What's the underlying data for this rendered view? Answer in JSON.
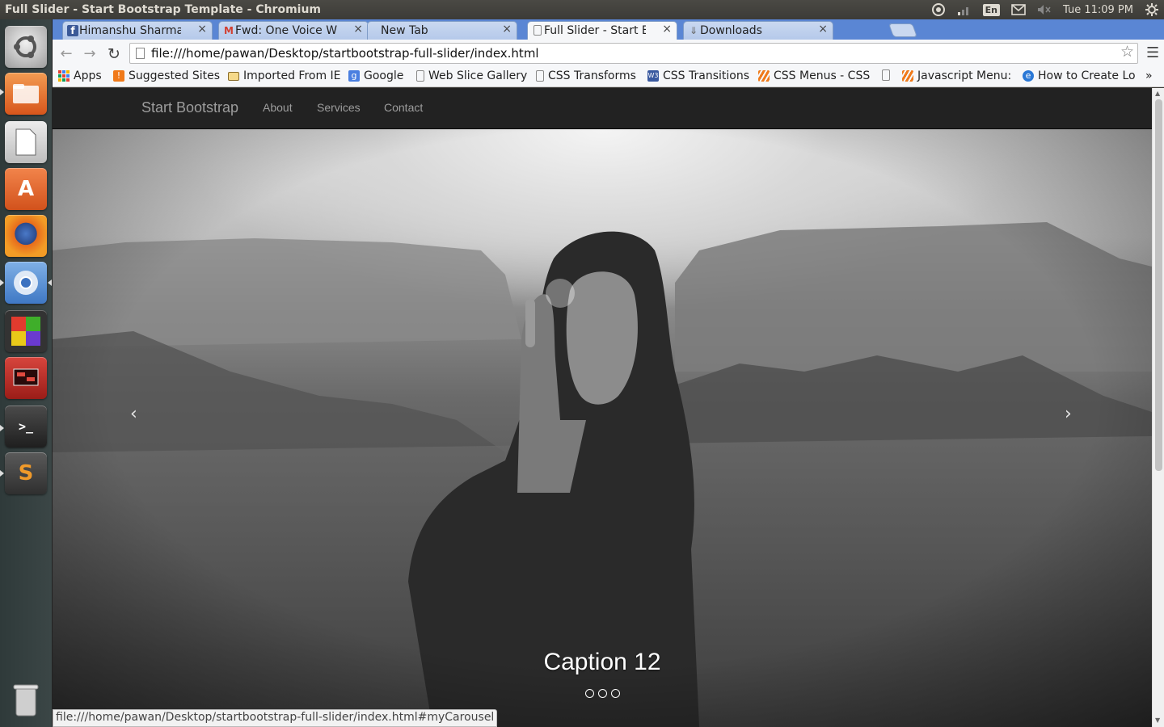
{
  "os": {
    "window_title": "Full Slider - Start Bootstrap Template - Chromium",
    "keyboard_layout": "En",
    "clock": "Tue 11:09 PM"
  },
  "launcher": {
    "items": [
      "ubuntu-dash",
      "files",
      "text-editor",
      "software-center",
      "firefox",
      "chromium",
      "color-app",
      "remmina",
      "terminal",
      "sublime-text",
      "trash"
    ]
  },
  "browser": {
    "tabs": [
      {
        "label": "Himanshu Sharma - ",
        "icon": "facebook-icon",
        "active": false
      },
      {
        "label": "Fwd: One Voice Web",
        "icon": "gmail-icon",
        "active": false
      },
      {
        "label": "New Tab",
        "icon": "",
        "active": false
      },
      {
        "label": "Full Slider - Start Boo",
        "icon": "page-icon",
        "active": true
      },
      {
        "label": "Downloads",
        "icon": "download-icon",
        "active": false
      }
    ],
    "close_glyph": "×",
    "url": "file:///home/pawan/Desktop/startbootstrap-full-slider/index.html",
    "bookmarks": [
      {
        "label": "Apps",
        "icon": "apps-grid-icon"
      },
      {
        "label": "Suggested Sites",
        "icon": "suggested-sites-icon"
      },
      {
        "label": "Imported From IE",
        "icon": "folder-icon"
      },
      {
        "label": "Google",
        "icon": "google-icon"
      },
      {
        "label": "Web Slice Gallery",
        "icon": "page-icon"
      },
      {
        "label": "CSS Transforms",
        "icon": "page-icon"
      },
      {
        "label": "CSS Transitions",
        "icon": "w3schools-icon"
      },
      {
        "label": "CSS Menus - CSS t",
        "icon": "stripes-icon"
      },
      {
        "label": "",
        "icon": "page-icon"
      },
      {
        "label": "Javascript Menu:",
        "icon": "stripes-icon"
      },
      {
        "label": "How to Create Lo",
        "icon": "ie-icon"
      }
    ],
    "bookmarks_overflow": "»",
    "status_url": "file:///home/pawan/Desktop/startbootstrap-full-slider/index.html#myCarousel"
  },
  "page": {
    "brand": "Start Bootstrap",
    "nav": [
      "About",
      "Services",
      "Contact"
    ],
    "carousel": {
      "caption": "Caption 12",
      "prev_glyph": "‹",
      "next_glyph": "›",
      "indicator_count": 3
    }
  },
  "colors": {
    "navbar_bg": "#222222",
    "navbar_text": "#9d9d9d",
    "tabstrip": "#5a86d4"
  }
}
